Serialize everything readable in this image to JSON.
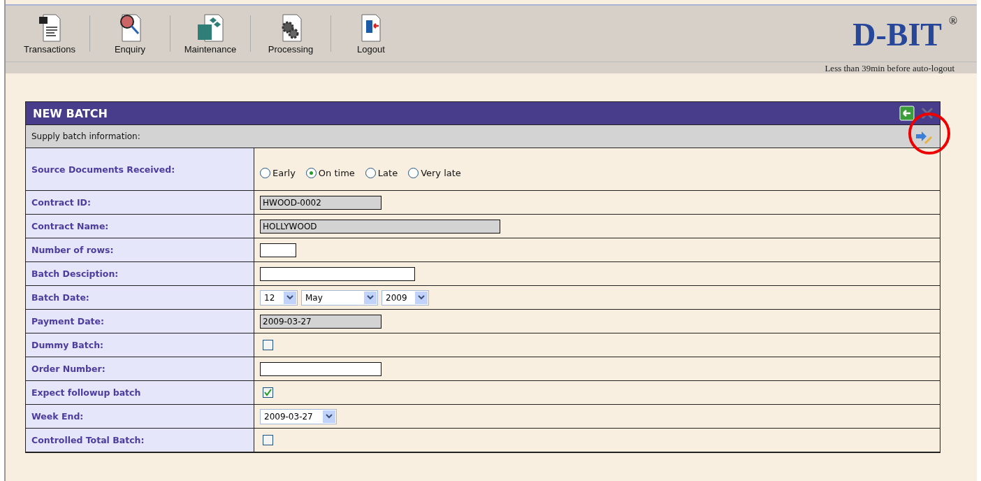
{
  "toolbar": [
    {
      "label": "Transactions"
    },
    {
      "label": "Enquiry"
    },
    {
      "label": "Maintenance"
    },
    {
      "label": "Processing"
    },
    {
      "label": "Logout"
    }
  ],
  "brand": {
    "logo": "D-BIT",
    "mark": "®",
    "session_notice": "Less than 39min before auto-logout"
  },
  "panel": {
    "title": "NEW BATCH",
    "subtitle": "Supply batch information:",
    "rows": [
      {
        "kind": "radio",
        "label": "Source Documents Received:",
        "options": [
          {
            "label": "Early",
            "selected": false
          },
          {
            "label": "On time",
            "selected": true
          },
          {
            "label": "Late",
            "selected": false
          },
          {
            "label": "Very late",
            "selected": false
          }
        ]
      },
      {
        "kind": "text",
        "label": "Contract ID:",
        "value": "HWOOD-0002",
        "readonly": true
      },
      {
        "kind": "text",
        "label": "Contract Name:",
        "value": "HOLLYWOOD",
        "readonly": true
      },
      {
        "kind": "text",
        "label": "Number of rows:",
        "readonly": false
      },
      {
        "kind": "text",
        "label": "Batch Desciption:",
        "readonly": false
      },
      {
        "kind": "select",
        "label": "Batch Date:",
        "values": [
          "12",
          "May",
          "2009"
        ]
      },
      {
        "kind": "text",
        "label": "Payment Date:",
        "value": "2009-03-27",
        "readonly": true
      },
      {
        "kind": "checkbox",
        "label": "Dummy Batch:",
        "checked": false
      },
      {
        "kind": "text",
        "label": "Order Number:",
        "readonly": false
      },
      {
        "kind": "checkbox",
        "label": "Expect followup batch",
        "checked": true
      },
      {
        "kind": "select",
        "label": "Week End:",
        "values": [
          "2009-03-27"
        ]
      },
      {
        "kind": "checkbox",
        "label": "Controlled Total Batch:",
        "checked": false
      }
    ]
  }
}
